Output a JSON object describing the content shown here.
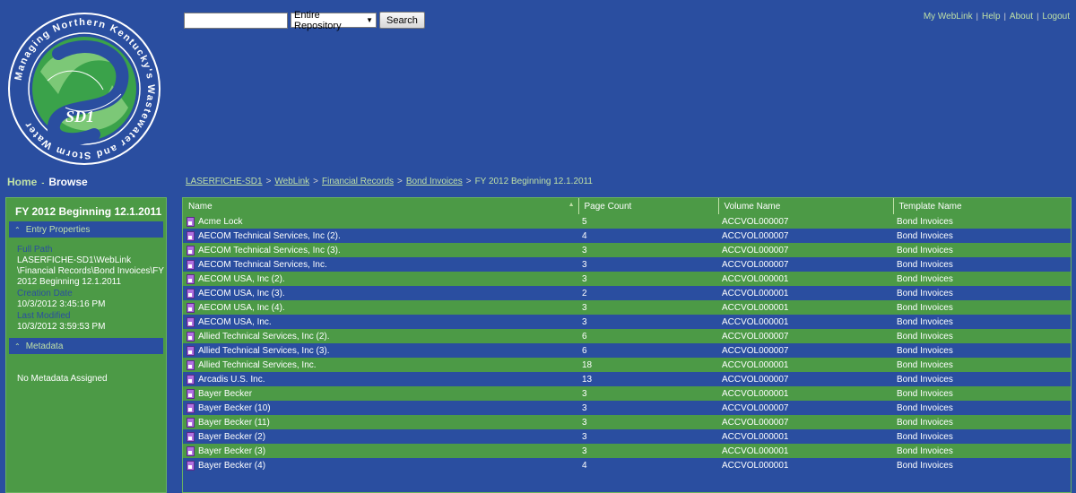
{
  "logo": {
    "ring_text": "Managing Northern Kentucky's Wastewater and Storm Water",
    "center_text": "SD1"
  },
  "search": {
    "value": "",
    "placeholder": "",
    "scope": "Entire Repository",
    "button": "Search"
  },
  "top_links": [
    "My WebLink",
    "Help",
    "About",
    "Logout"
  ],
  "nav": {
    "home": "Home",
    "separator": "-",
    "browse": "Browse"
  },
  "breadcrumb": {
    "items": [
      "LASERFICHE-SD1",
      "WebLink",
      "Financial Records",
      "Bond Invoices"
    ],
    "current": "FY 2012 Beginning 12.1.2011",
    "separator": ">"
  },
  "sidebar": {
    "title": "FY 2012 Beginning 12.1.2011",
    "entry_properties_header": "Entry Properties",
    "full_path_label": "Full Path",
    "full_path_value": "LASERFICHE-SD1\\WebLink \\Financial Records\\Bond Invoices\\FY 2012 Beginning 12.1.2011",
    "creation_date_label": "Creation Date",
    "creation_date_value": "10/3/2012 3:45:16 PM",
    "last_modified_label": "Last Modified",
    "last_modified_value": "10/3/2012 3:59:53 PM",
    "metadata_header": "Metadata",
    "metadata_value": "No Metadata Assigned"
  },
  "table": {
    "columns": [
      "Name",
      "Page Count",
      "Volume Name",
      "Template Name"
    ],
    "rows": [
      [
        "Acme Lock",
        "5",
        "ACCVOL000007",
        "Bond Invoices"
      ],
      [
        "AECOM Technical Services, Inc (2).",
        "4",
        "ACCVOL000007",
        "Bond Invoices"
      ],
      [
        "AECOM Technical Services, Inc (3).",
        "3",
        "ACCVOL000007",
        "Bond Invoices"
      ],
      [
        "AECOM Technical Services, Inc.",
        "3",
        "ACCVOL000007",
        "Bond Invoices"
      ],
      [
        "AECOM USA, Inc (2).",
        "3",
        "ACCVOL000001",
        "Bond Invoices"
      ],
      [
        "AECOM USA, Inc (3).",
        "2",
        "ACCVOL000001",
        "Bond Invoices"
      ],
      [
        "AECOM USA, Inc (4).",
        "3",
        "ACCVOL000001",
        "Bond Invoices"
      ],
      [
        "AECOM USA, Inc.",
        "3",
        "ACCVOL000001",
        "Bond Invoices"
      ],
      [
        "Allied Technical Services, Inc (2).",
        "6",
        "ACCVOL000007",
        "Bond Invoices"
      ],
      [
        "Allied Technical Services, Inc (3).",
        "6",
        "ACCVOL000007",
        "Bond Invoices"
      ],
      [
        "Allied Technical Services, Inc.",
        "18",
        "ACCVOL000001",
        "Bond Invoices"
      ],
      [
        "Arcadis U.S. Inc.",
        "13",
        "ACCVOL000007",
        "Bond Invoices"
      ],
      [
        "Bayer Becker",
        "3",
        "ACCVOL000001",
        "Bond Invoices"
      ],
      [
        "Bayer Becker (10)",
        "3",
        "ACCVOL000007",
        "Bond Invoices"
      ],
      [
        "Bayer Becker (11)",
        "3",
        "ACCVOL000007",
        "Bond Invoices"
      ],
      [
        "Bayer Becker (2)",
        "3",
        "ACCVOL000001",
        "Bond Invoices"
      ],
      [
        "Bayer Becker (3)",
        "3",
        "ACCVOL000001",
        "Bond Invoices"
      ],
      [
        "Bayer Becker (4)",
        "4",
        "ACCVOL000001",
        "Bond Invoices"
      ]
    ]
  },
  "colors": {
    "background_blue": "#2a4ea0",
    "green": "#4c9a46",
    "link_green": "#bfe0a6"
  }
}
